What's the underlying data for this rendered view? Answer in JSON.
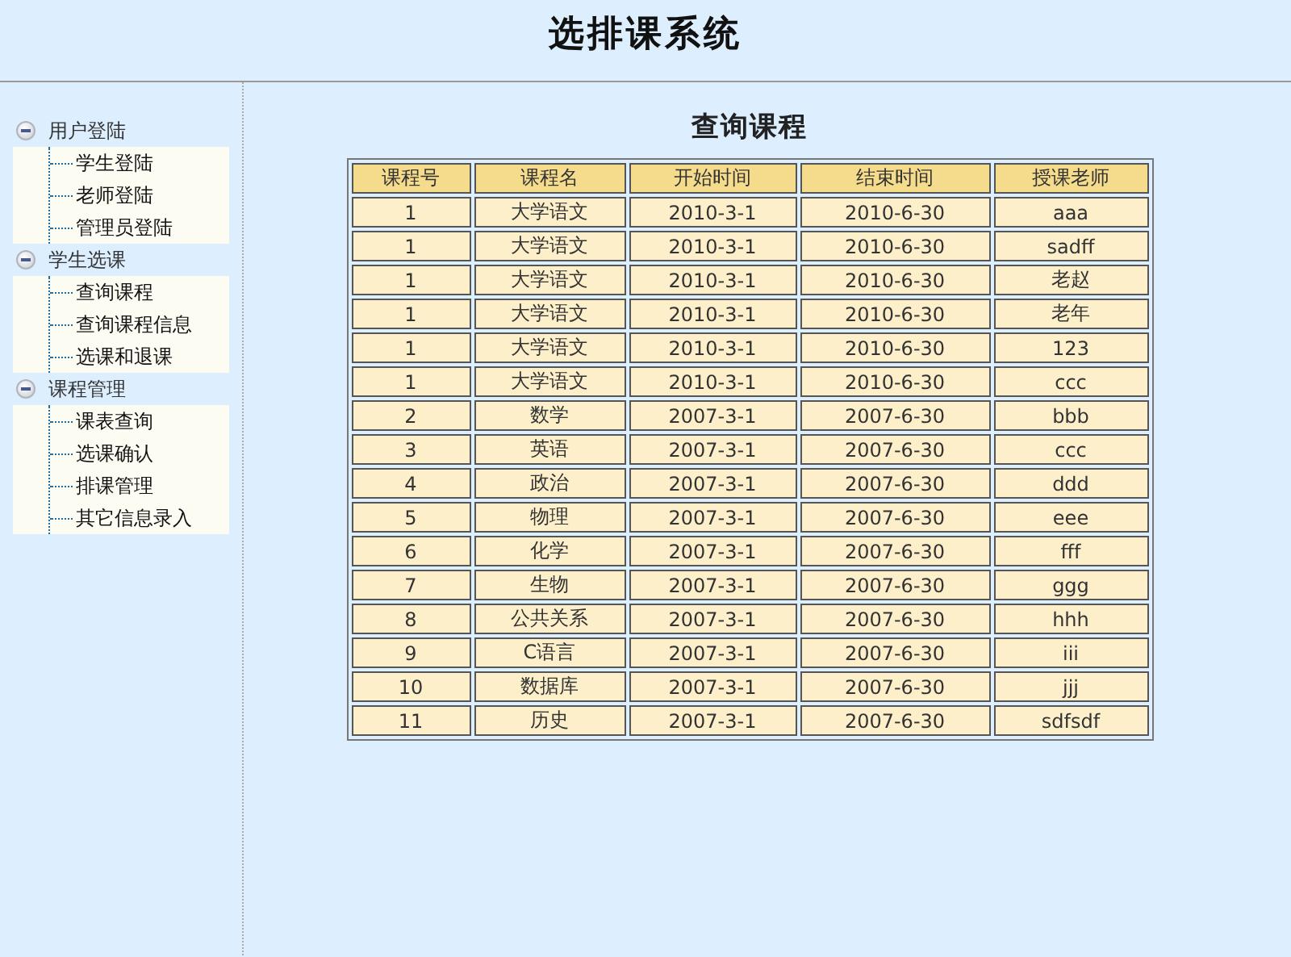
{
  "header": {
    "title": "选排课系统"
  },
  "sidebar": {
    "groups": [
      {
        "label": "用户登陆",
        "expanded": true,
        "items": [
          "学生登陆",
          "老师登陆",
          "管理员登陆"
        ]
      },
      {
        "label": "学生选课",
        "expanded": true,
        "items": [
          "查询课程",
          "查询课程信息",
          "选课和退课"
        ]
      },
      {
        "label": "课程管理",
        "expanded": true,
        "items": [
          "课表查询",
          "选课确认",
          "排课管理",
          "其它信息录入"
        ]
      }
    ]
  },
  "main": {
    "title": "查询课程",
    "table": {
      "columns": [
        "课程号",
        "课程名",
        "开始时间",
        "结束时间",
        "授课老师"
      ],
      "rows": [
        [
          "1",
          "大学语文",
          "2010-3-1",
          "2010-6-30",
          "aaa"
        ],
        [
          "1",
          "大学语文",
          "2010-3-1",
          "2010-6-30",
          "sadff"
        ],
        [
          "1",
          "大学语文",
          "2010-3-1",
          "2010-6-30",
          "老赵"
        ],
        [
          "1",
          "大学语文",
          "2010-3-1",
          "2010-6-30",
          "老年"
        ],
        [
          "1",
          "大学语文",
          "2010-3-1",
          "2010-6-30",
          "123"
        ],
        [
          "1",
          "大学语文",
          "2010-3-1",
          "2010-6-30",
          "ccc"
        ],
        [
          "2",
          "数学",
          "2007-3-1",
          "2007-6-30",
          "bbb"
        ],
        [
          "3",
          "英语",
          "2007-3-1",
          "2007-6-30",
          "ccc"
        ],
        [
          "4",
          "政治",
          "2007-3-1",
          "2007-6-30",
          "ddd"
        ],
        [
          "5",
          "物理",
          "2007-3-1",
          "2007-6-30",
          "eee"
        ],
        [
          "6",
          "化学",
          "2007-3-1",
          "2007-6-30",
          "fff"
        ],
        [
          "7",
          "生物",
          "2007-3-1",
          "2007-6-30",
          "ggg"
        ],
        [
          "8",
          "公共关系",
          "2007-3-1",
          "2007-6-30",
          "hhh"
        ],
        [
          "9",
          "C语言",
          "2007-3-1",
          "2007-6-30",
          "iii"
        ],
        [
          "10",
          "数据库",
          "2007-3-1",
          "2007-6-30",
          "jjj"
        ],
        [
          "11",
          "历史",
          "2007-3-1",
          "2007-6-30",
          "sdfsdf"
        ]
      ]
    }
  }
}
